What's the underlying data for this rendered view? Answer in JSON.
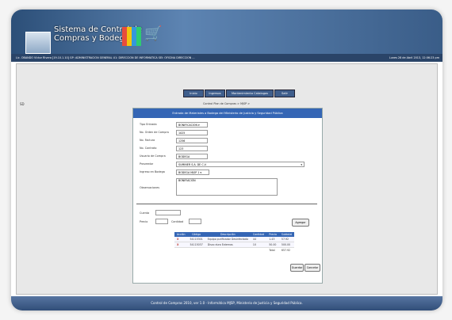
{
  "header": {
    "title_line1": "Sistema de Control de",
    "title_line2": "Compras y Bodega",
    "logo_caption": "MJSP"
  },
  "infobar": {
    "left": "Lic. OBANDO Víctor Rivera [19.10.1.10]   GP: ADMINISTRACION GENERAL   U1: DIRECCION DE INFORMATICA   SEI: OFICINA DIRECCION ...",
    "right": "Lunes 28 de Abril 2013, 12:06:23 pm"
  },
  "side_label": "SD",
  "nav": [
    "Inicio",
    "Ingresos",
    "Mantenimiento Catalogos",
    "Salir"
  ],
  "breadcrumb": "Control Plan de Compras > MJSP >",
  "panel": {
    "title": "Entrada de Materiales a Bodega del Ministerio de Justicia y Seguridad Pública",
    "fields": [
      {
        "label": "Tipo Entrada",
        "value": "BONIFICACION"
      },
      {
        "label": "No. Orden de Compra",
        "value": "1025"
      },
      {
        "label": "No. Factura",
        "value": "1256"
      },
      {
        "label": "No. Contrato",
        "value": "123"
      },
      {
        "label": "Usuario de Compra",
        "value": "BODEGA"
      },
      {
        "label": "Proveedor",
        "value": "SUMINER S.A. DE C.V."
      },
      {
        "label": "Ingreso en Bodega",
        "value": "BODEGA MJSP 1"
      },
      {
        "label": "Observaciones",
        "value": "BONIFIACIÓN"
      }
    ],
    "cuenta_label": "Cuenta",
    "precio_label": "Precio",
    "cantidad_label": "Cantidad",
    "agregar": "Agregar",
    "table": {
      "headers": [
        "Acción",
        "Código",
        "Descripción",
        "Cantidad",
        "Precio",
        "Subtotal"
      ],
      "rows": [
        [
          "X",
          "54115301",
          "Equipo purificador Desinfectado",
          "44",
          "1.43",
          "57.92"
        ],
        [
          "X",
          "54115037",
          "Disco duro Externos",
          "10",
          "50.00",
          "500.00"
        ]
      ],
      "total_label": "Total",
      "total_value": "657.92"
    },
    "buttons": {
      "guardar": "Guardar",
      "cancelar": "Cancelar"
    }
  },
  "footer": "Control de Compras 2010, ver 1.0 - Informática MJSP, Ministerio de Justicia y Seguridad Pública."
}
